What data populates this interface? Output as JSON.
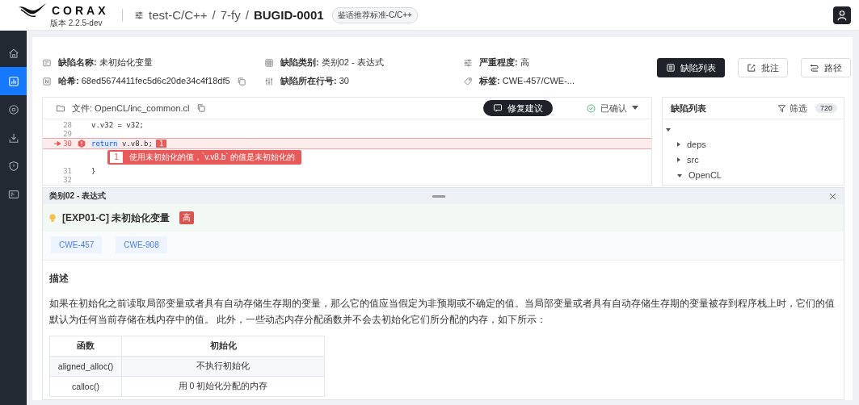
{
  "header": {
    "logo": "CORAX",
    "version": "版本 2.2.5-dev",
    "breadcrumb": [
      {
        "text": "test-C/C++",
        "kind": "link"
      },
      {
        "text": "/",
        "kind": "separator"
      },
      {
        "text": "7-fy",
        "kind": "link"
      },
      {
        "text": "/",
        "kind": "separator"
      },
      {
        "text": "BUGID-0001",
        "kind": "current"
      }
    ],
    "badge": "鉴语推荐标准-C/C++"
  },
  "sidebar": {
    "items": [
      {
        "kind": "home",
        "selected": false
      },
      {
        "kind": "chart",
        "selected": true
      },
      {
        "kind": "target",
        "selected": false
      },
      {
        "kind": "download",
        "selected": false
      },
      {
        "kind": "shield",
        "selected": false
      },
      {
        "kind": "beta",
        "selected": false
      }
    ]
  },
  "defect_info": {
    "fields": [
      {
        "kind": "name",
        "label": "缺陷名称:",
        "value": "未初始化变量"
      },
      {
        "kind": "category",
        "label": "缺陷类别:",
        "value": "类别02 - 表达式"
      },
      {
        "kind": "severity",
        "label": "严重程度:",
        "value": "高"
      },
      {
        "kind": "hash",
        "label": "哈希:",
        "value": "68ed5674411fec5d6c20de34c4f18df5"
      },
      {
        "kind": "line",
        "label": "缺陷所在行号:",
        "value": "30"
      },
      {
        "kind": "tags",
        "label": "标签:",
        "value": "CWE-457/CWE-..."
      }
    ]
  },
  "actions": [
    {
      "kind": "list",
      "label": "缺陷列表",
      "selected": true
    },
    {
      "kind": "annotate",
      "label": "批注",
      "selected": false
    },
    {
      "kind": "path",
      "label": "路径",
      "selected": false
    }
  ],
  "code_panel": {
    "file": "文件: OpenCL/inc_common.cl",
    "fix_button": "修复建议",
    "status": "已确认",
    "lines": [
      {
        "number": "28",
        "error": false,
        "tokens": [
          {
            "kind": "plain",
            "text": "v.v32 = v32;"
          }
        ]
      },
      {
        "number": "29",
        "error": false
      },
      {
        "number": "30",
        "error": true,
        "tokens": [
          {
            "kind": "keyword",
            "text": "return"
          },
          {
            "kind": "plain",
            "text": " v.v8.b;"
          }
        ],
        "marker": "1",
        "annotation": {
          "index": "1",
          "message": "使用未初始化的值，`v.v8.b` 的值是未初始化的"
        }
      },
      {
        "number": "31",
        "error": false,
        "tokens": [
          {
            "kind": "plain",
            "text": "}"
          }
        ]
      },
      {
        "number": "32",
        "error": false
      }
    ]
  },
  "defect_list": {
    "title": "缺陷列表",
    "filter": "筛选",
    "count": "720",
    "tree": [
      {
        "expanded": true,
        "children": [
          {
            "label": "deps",
            "expanded": false
          },
          {
            "label": "src",
            "expanded": false
          },
          {
            "label": "OpenCL",
            "expanded": true
          }
        ]
      }
    ]
  },
  "detail_sheet": {
    "title": "类别02 - 表达式",
    "rule": "[EXP01-C] 未初始化变量",
    "severity": "高",
    "tags": [
      "CWE-457",
      "CWE-908"
    ],
    "section_title": "描述",
    "description": "如果在初始化之前读取局部变量或者具有自动存储生存期的变量，那么它的值应当假定为非预期或不确定的值。当局部变量或者具有自动存储生存期的变量被存到程序栈上时，它们的值默认为任何当前存储在栈内存中的值。 此外，一些动态内存分配函数并不会去初始化它们所分配的内存，如下所示：",
    "table": {
      "columns": [
        "函数",
        "初始化"
      ],
      "rows": [
        [
          "aligned_alloc()",
          "不执行初始化"
        ],
        [
          "calloc()",
          "用 0 初始化分配的内存"
        ]
      ]
    }
  }
}
